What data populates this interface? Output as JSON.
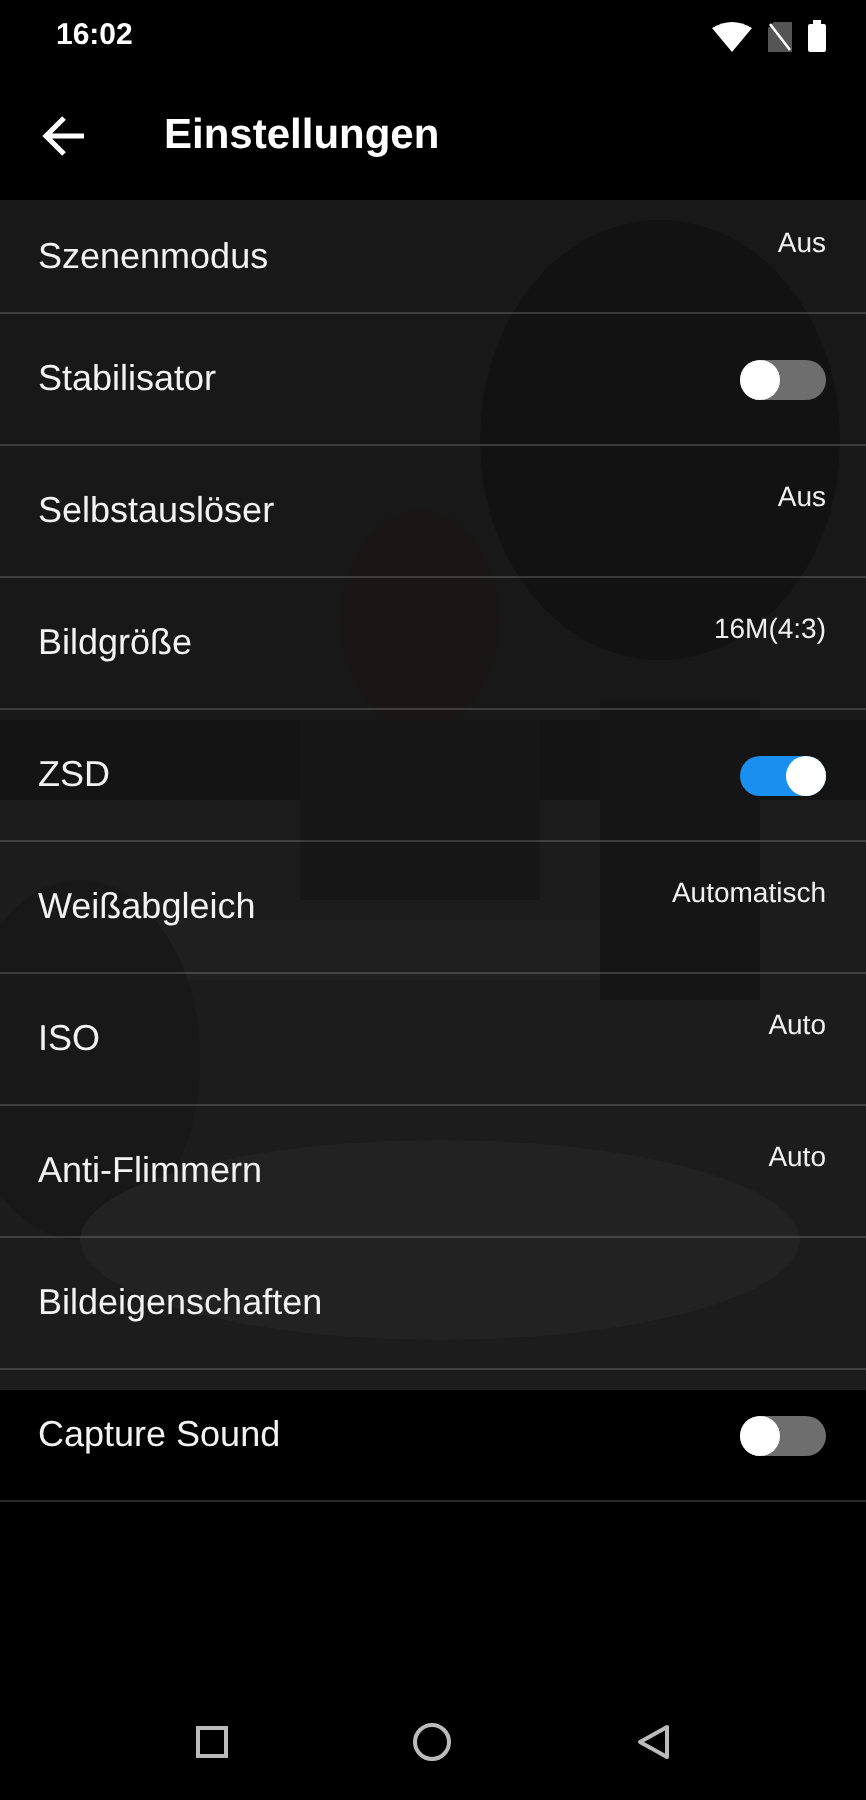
{
  "status_bar": {
    "time": "16:02"
  },
  "app_bar": {
    "title": "Einstellungen"
  },
  "settings": [
    {
      "kind": "value",
      "label": "Szenenmodus",
      "value": "Aus"
    },
    {
      "kind": "toggle",
      "label": "Stabilisator",
      "on": false
    },
    {
      "kind": "value",
      "label": "Selbstauslöser",
      "value": "Aus"
    },
    {
      "kind": "value",
      "label": "Bildgröße",
      "value": "16M(4:3)"
    },
    {
      "kind": "toggle",
      "label": "ZSD",
      "on": true
    },
    {
      "kind": "value",
      "label": "Weißabgleich",
      "value": "Automatisch"
    },
    {
      "kind": "value",
      "label": "ISO",
      "value": "Auto"
    },
    {
      "kind": "value",
      "label": "Anti-Flimmern",
      "value": "Auto"
    },
    {
      "kind": "link",
      "label": "Bildeigenschaften"
    },
    {
      "kind": "toggle",
      "label": "Capture Sound",
      "on": false
    }
  ]
}
